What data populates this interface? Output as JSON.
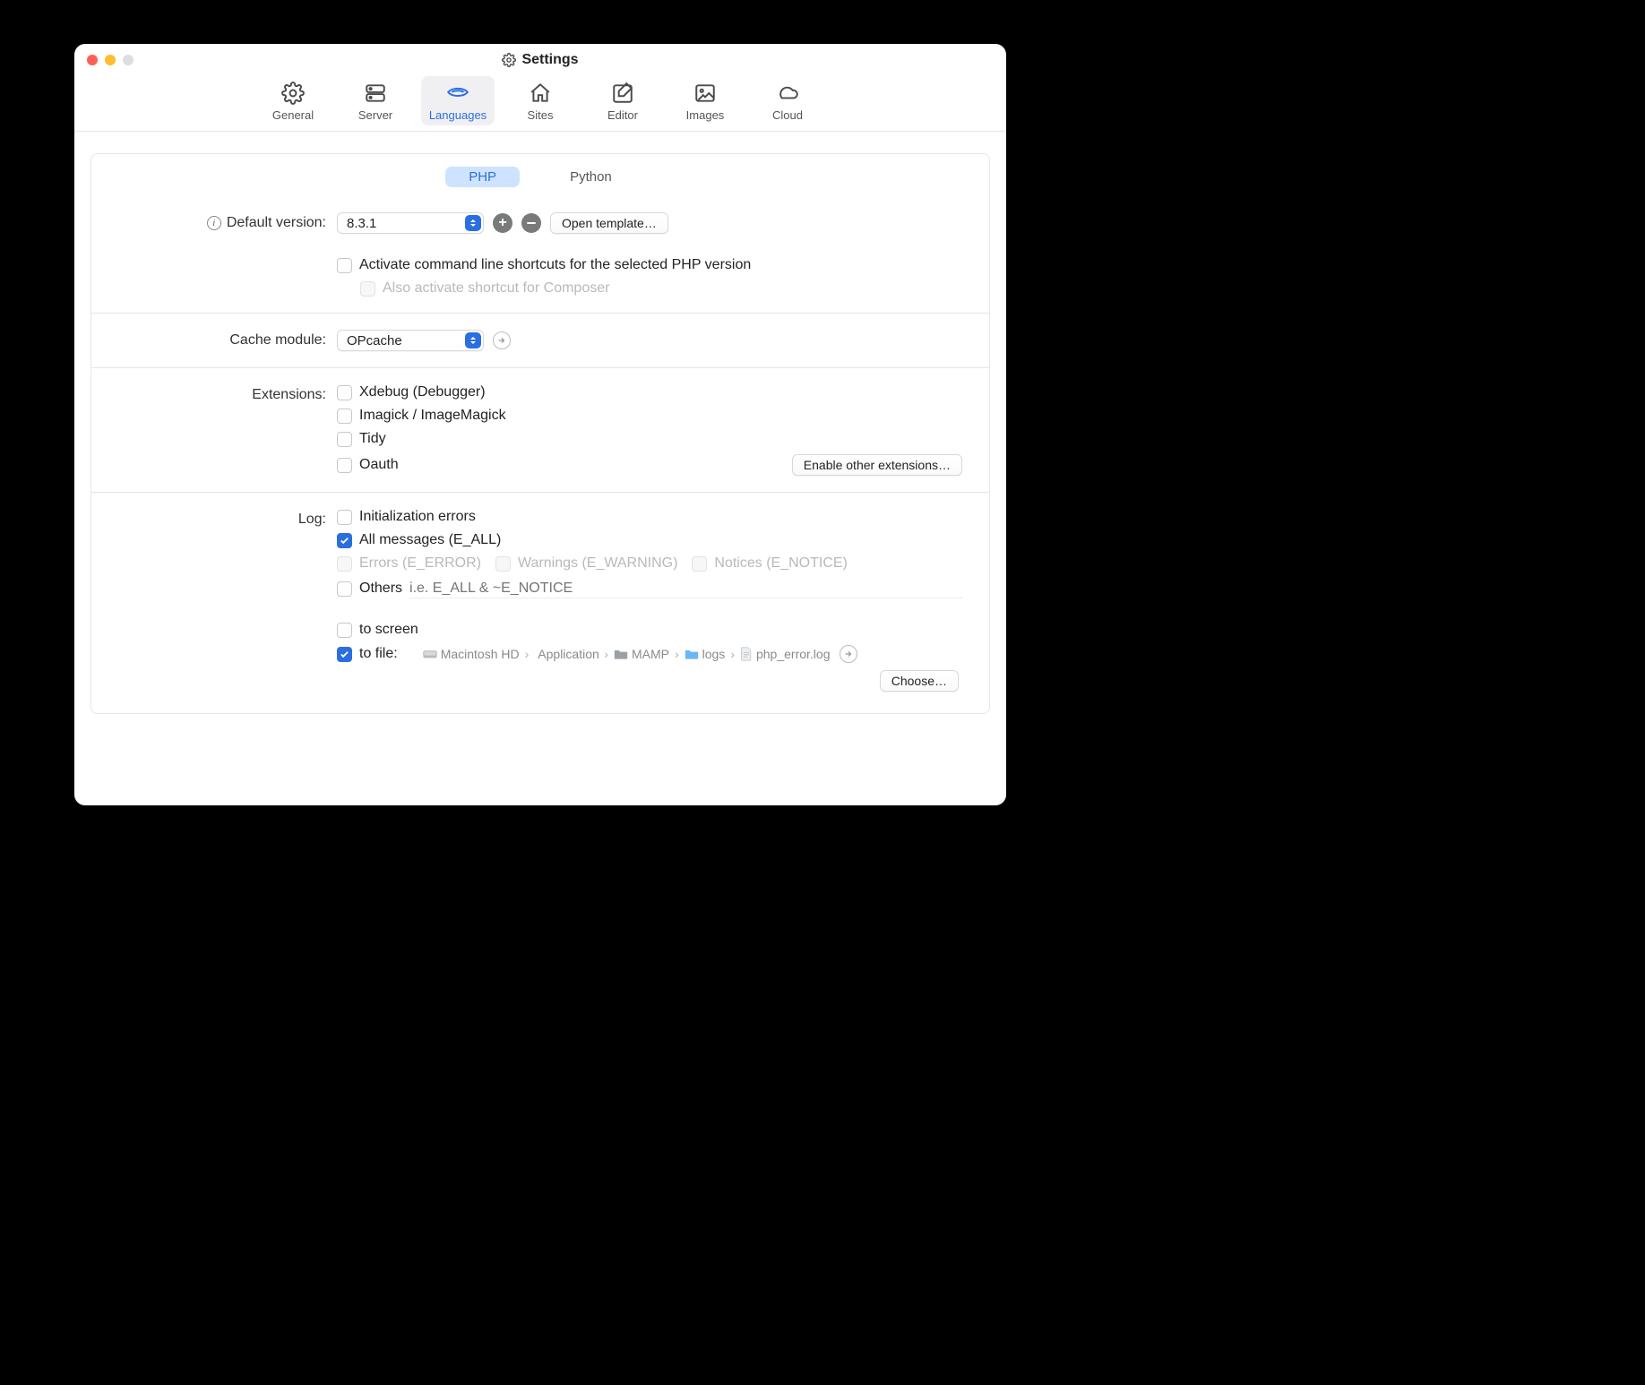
{
  "window": {
    "title": "Settings"
  },
  "toolbar": {
    "items": [
      {
        "id": "general",
        "label": "General"
      },
      {
        "id": "server",
        "label": "Server"
      },
      {
        "id": "languages",
        "label": "Languages"
      },
      {
        "id": "sites",
        "label": "Sites"
      },
      {
        "id": "editor",
        "label": "Editor"
      },
      {
        "id": "images",
        "label": "Images"
      },
      {
        "id": "cloud",
        "label": "Cloud"
      }
    ],
    "selected": "languages"
  },
  "segmented": {
    "php": "PHP",
    "python": "Python",
    "active": "php"
  },
  "php": {
    "default_version_label": "Default version:",
    "default_version_value": "8.3.1",
    "open_template": "Open template…",
    "activate_cli": "Activate command line shortcuts for the selected PHP version",
    "activate_composer": "Also activate shortcut for Composer",
    "cache_module_label": "Cache module:",
    "cache_module_value": "OPcache",
    "extensions_label": "Extensions:",
    "ext_xdebug": "Xdebug (Debugger)",
    "ext_imagick": "Imagick / ImageMagick",
    "ext_tidy": "Tidy",
    "ext_oauth": "Oauth",
    "enable_other_ext": "Enable other extensions…",
    "log_label": "Log:",
    "log_init": "Initialization errors",
    "log_all": "All messages (E_ALL)",
    "log_errors": "Errors (E_ERROR)",
    "log_warnings": "Warnings (E_WARNING)",
    "log_notices": "Notices (E_NOTICE)",
    "log_others": "Others",
    "log_others_placeholder": "i.e. E_ALL & ~E_NOTICE",
    "log_screen": "to screen",
    "log_file": "to file:",
    "choose": "Choose…",
    "path": {
      "root": "Macintosh HD",
      "p1": "Applications",
      "p2": "MAMP",
      "p3": "logs",
      "file": "php_error.log"
    }
  }
}
